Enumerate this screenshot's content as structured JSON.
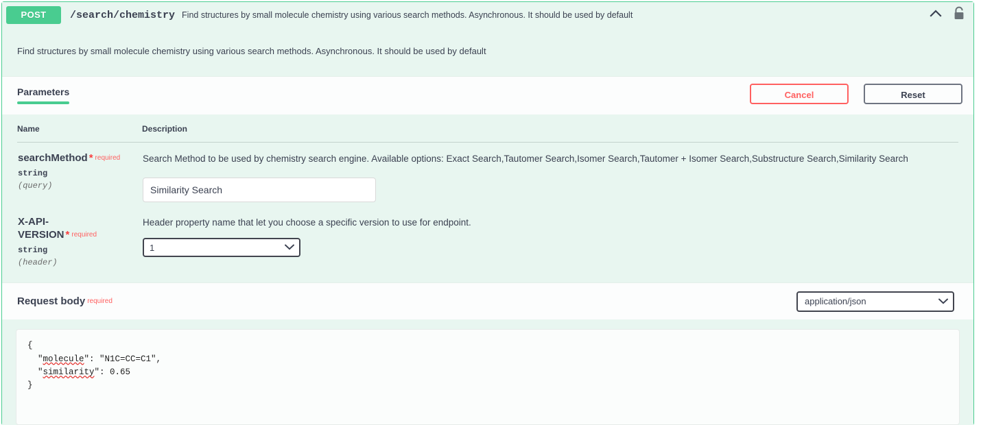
{
  "operation": {
    "method": "POST",
    "path": "/search/chemistry",
    "summary": "Find structures by small molecule chemistry using various search methods. Asynchronous. It should be used by default",
    "description": "Find structures by small molecule chemistry using various search methods. Asynchronous. It should be used by default",
    "collapse_icon": "chevron-up-icon",
    "auth_icon": "lock-icon",
    "method_color": "#49cc90",
    "block_border_color": "#49cc90",
    "block_background": "#e8f6f0"
  },
  "tabs": [
    {
      "label": "Parameters",
      "active": true
    }
  ],
  "actions": {
    "cancel_label": "Cancel",
    "cancel_color": "#ff6060",
    "reset_label": "Reset",
    "reset_color": "#6e7481"
  },
  "parameters_table": {
    "headers": {
      "name": "Name",
      "description": "Description"
    },
    "rows": [
      {
        "name": "searchMethod",
        "required_star": "*",
        "required_label": "required",
        "type": "string",
        "in": "(query)",
        "description": "Search Method to be used by chemistry search engine. Available options: Exact Search,Tautomer Search,Isomer Search,Tautomer + Isomer Search,Substructure Search,Similarity Search",
        "control": "text",
        "value": "Similarity Search",
        "placeholder": "searchMethod"
      },
      {
        "name": "X-API-VERSION",
        "required_star": "*",
        "required_label": "required",
        "type": "string",
        "in": "(header)",
        "description": "Header property name that let you choose a specific version to use for endpoint.",
        "control": "select",
        "value": "1",
        "options": [
          "1"
        ]
      }
    ]
  },
  "request_body": {
    "title": "Request body",
    "required_label": "required",
    "media_type": "application/json",
    "media_options": [
      "application/json"
    ],
    "content_lines": [
      "{",
      "  \"molecule\": \"N1C=CC=C1\",",
      "  \"similarity\": 0.65",
      "}"
    ],
    "content": "{\n  \"molecule\": \"N1C=CC=C1\",\n  \"similarity\": 0.65\n}",
    "spellcheck_words": [
      "molecule",
      "similarity"
    ]
  }
}
